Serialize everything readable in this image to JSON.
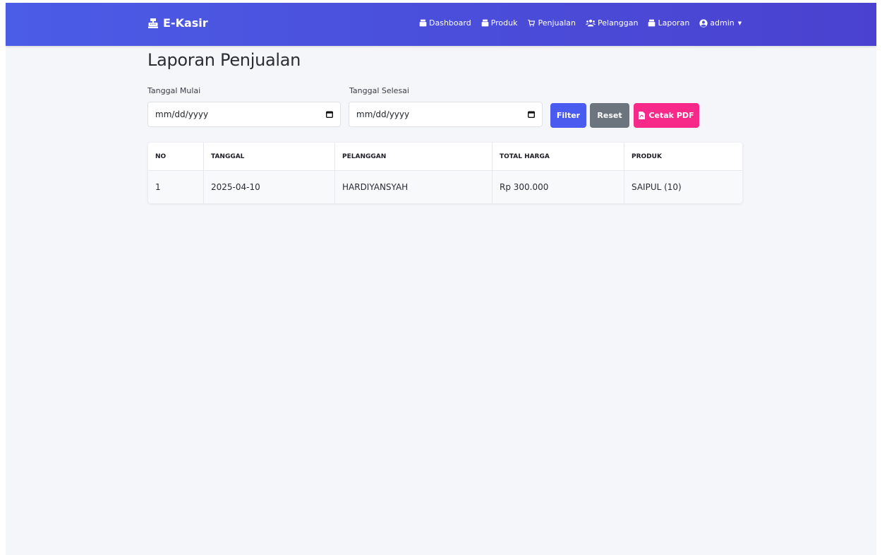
{
  "navbar": {
    "brand": "E-Kasir",
    "items": [
      {
        "label": "Dashboard",
        "icon": "cash-register-icon"
      },
      {
        "label": "Produk",
        "icon": "cash-register-icon"
      },
      {
        "label": "Penjualan",
        "icon": "shopping-cart-icon"
      },
      {
        "label": "Pelanggan",
        "icon": "users-icon"
      },
      {
        "label": "Laporan",
        "icon": "cash-register-icon"
      },
      {
        "label": "admin",
        "icon": "user-circle-icon"
      }
    ]
  },
  "page": {
    "title": "Laporan Penjualan"
  },
  "filters": {
    "start_label": "Tanggal Mulai",
    "start_placeholder": "mm/dd/yyyy",
    "end_label": "Tanggal Selesai",
    "end_placeholder": "mm/dd/yyyy"
  },
  "buttons": {
    "filter": "Filter",
    "reset": "Reset",
    "pdf": "Cetak PDF"
  },
  "table": {
    "headers": [
      "NO",
      "TANGGAL",
      "PELANGGAN",
      "TOTAL HARGA",
      "PRODUK"
    ],
    "rows": [
      {
        "no": "1",
        "tanggal": "2025-04-10",
        "pelanggan": "HARDIYANSYAH",
        "total": "Rp 300.000",
        "produk": "SAIPUL (10)"
      }
    ]
  },
  "colors": {
    "navbar_start": "#4b5ce6",
    "navbar_end": "#4a41cf",
    "filter_button": "#4a5bef",
    "reset_button": "#6c757d",
    "pdf_button": "#f72a8a",
    "background": "#f5f6fa"
  }
}
